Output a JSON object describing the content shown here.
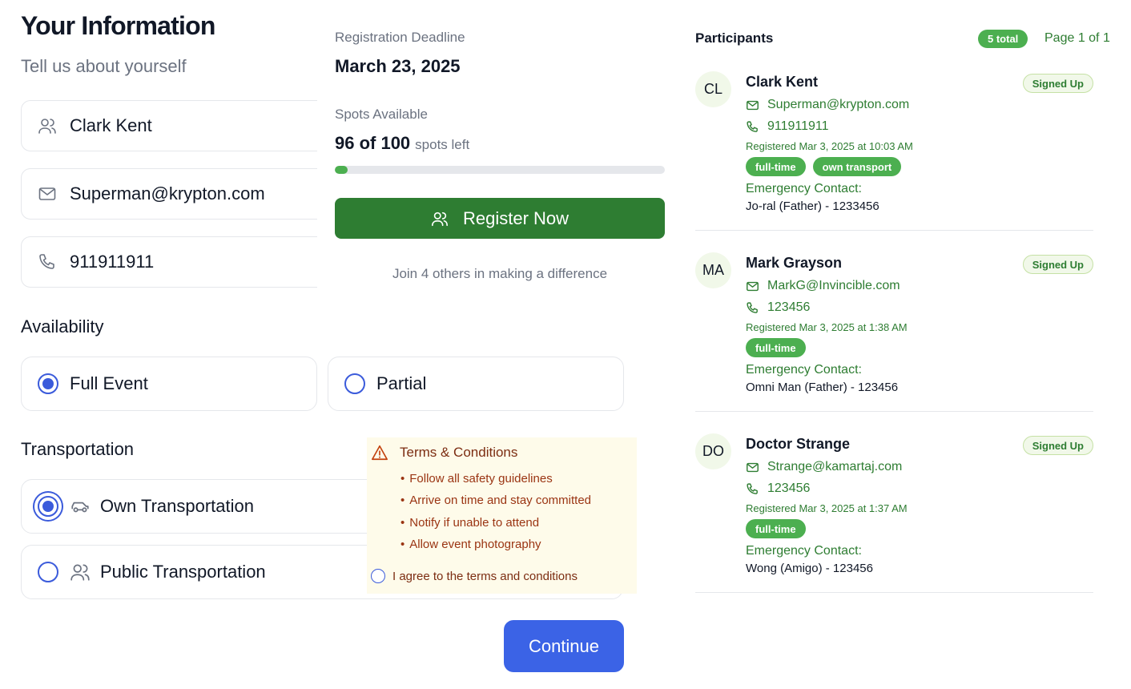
{
  "form": {
    "title": "Your Information",
    "subtitle": "Tell us about yourself",
    "name_value": "Clark Kent",
    "email_value": "Superman@krypton.com",
    "phone_value": "911911911",
    "availability_label": "Availability",
    "availability_options": [
      {
        "label": "Full Event",
        "selected": true
      },
      {
        "label": "Partial",
        "selected": false
      }
    ],
    "transportation_label": "Transportation",
    "transport_options": [
      {
        "label": "Own Transportation",
        "icon": "car-icon",
        "selected": true
      },
      {
        "label": "Public Transportation",
        "icon": "users-icon",
        "selected": false
      }
    ],
    "continue_label": "Continue"
  },
  "event": {
    "deadline_label": "Registration Deadline",
    "deadline_value": "March 23, 2025",
    "spots_label": "Spots Available",
    "spots_value": "96 of 100",
    "spots_suffix": "spots left",
    "spots_filled_fraction": 0.04,
    "register_label": "Register Now",
    "join_text": "Join 4 others in making a difference"
  },
  "terms": {
    "title": "Terms & Conditions",
    "items": [
      "Follow all safety guidelines",
      "Arrive on time and stay committed",
      "Notify if unable to attend",
      "Allow event photography"
    ],
    "agree_label": "I agree to the terms and conditions"
  },
  "participants": {
    "title": "Participants",
    "total_badge": "5 total",
    "page_info": "Page 1 of 1",
    "list": [
      {
        "initials": "CL",
        "name": "Clark Kent",
        "status": "Signed Up",
        "email": "Superman@krypton.com",
        "phone": "911911911",
        "registered": "Registered Mar 3, 2025 at 10:03 AM",
        "tags": [
          "full-time",
          "own transport"
        ],
        "emergency_label": "Emergency Contact:",
        "emergency_value": "Jo-ral (Father) - 1233456"
      },
      {
        "initials": "MA",
        "name": "Mark Grayson",
        "status": "Signed Up",
        "email": "MarkG@Invincible.com",
        "phone": "123456",
        "registered": "Registered Mar 3, 2025 at 1:38 AM",
        "tags": [
          "full-time"
        ],
        "emergency_label": "Emergency Contact:",
        "emergency_value": "Omni Man (Father) - 123456"
      },
      {
        "initials": "DO",
        "name": "Doctor Strange",
        "status": "Signed Up",
        "email": "Strange@kamartaj.com",
        "phone": "123456",
        "registered": "Registered Mar 3, 2025 at 1:37 AM",
        "tags": [
          "full-time"
        ],
        "emergency_label": "Emergency Contact:",
        "emergency_value": "Wong (Amigo) - 123456"
      }
    ]
  },
  "colors": {
    "primary_blue": "#3b63e6",
    "brand_green": "#2e7d32",
    "tag_green": "#4caf50",
    "terms_bg": "#fefbea"
  }
}
